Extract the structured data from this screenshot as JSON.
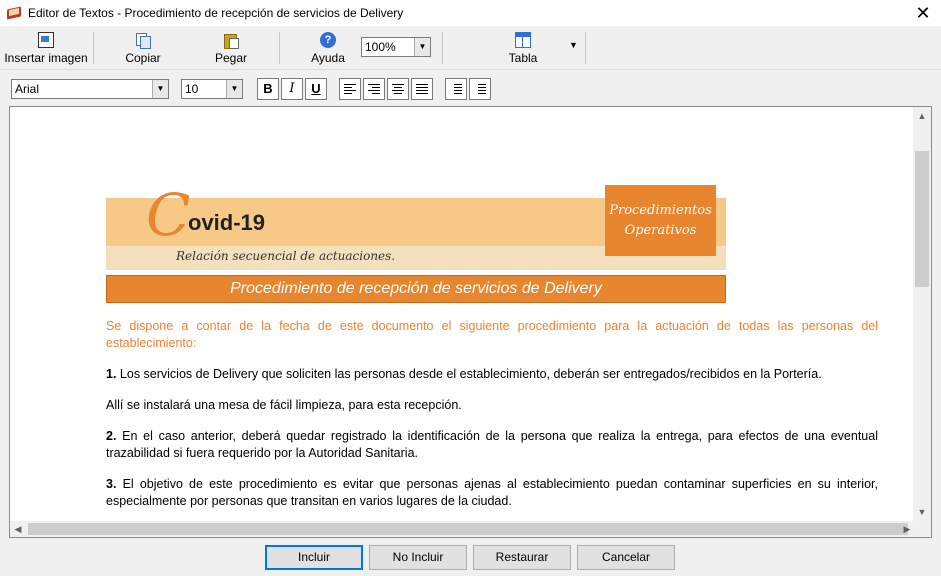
{
  "window": {
    "title": "Editor de Textos - Procedimiento de recepción de servicios de Delivery",
    "close_glyph": "✕"
  },
  "toolbar": {
    "insert_image": "Insertar imagen",
    "copy": "Copiar",
    "paste": "Pegar",
    "help": "Ayuda",
    "zoom": "100%",
    "table": "Tabla"
  },
  "format": {
    "font": "Arial",
    "size": "10",
    "bold": "B",
    "italic": "I",
    "underline": "U"
  },
  "document": {
    "logo_letter": "C",
    "logo_word": "ovid-19",
    "subtitle": "Relación secuencial de actuaciones.",
    "box_line1": "Procedimientos",
    "box_line2": "Operativos",
    "heading": "Procedimiento de recepción de servicios de Delivery",
    "intro": "Se dispone a contar de la fecha de este documento el siguiente procedimiento para la actuación de todas las personas del establecimiento:",
    "p1_num": "1.",
    "p1": " Los servicios de Delivery que soliciten las personas desde el establecimiento, deberán ser entregados/recibidos en la Portería.",
    "p1b": "Allí se instalará una mesa de fácil limpieza, para esta recepción.",
    "p2_num": "2.",
    "p2": " En el caso anterior, deberá quedar registrado la identificación de la persona que realiza la entrega, para efectos de una eventual trazabilidad si fuera requerido por la Autoridad Sanitaria.",
    "p3_num": "3.",
    "p3": " El objetivo de este procedimiento es evitar que personas ajenas al establecimiento puedan contaminar superficies en su interior, especialmente por personas que transitan en varios lugares de la ciudad."
  },
  "buttons": {
    "include": "Incluir",
    "not_include": "No Incluir",
    "restore": "Restaurar",
    "cancel": "Cancelar"
  },
  "colors": {
    "accent": "#e8852f",
    "band_light": "#f6c987",
    "band_lighter": "#f5e0bd"
  }
}
